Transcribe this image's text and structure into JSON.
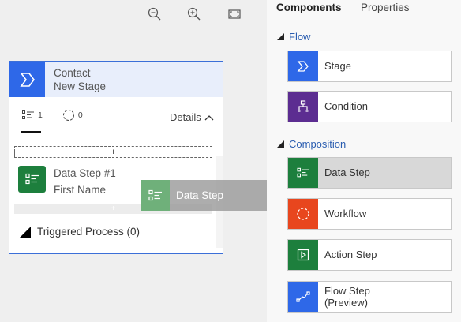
{
  "toolbar": {
    "zoom_out_icon": "zoom-out-icon",
    "zoom_in_icon": "zoom-in-icon",
    "fit_icon": "fit-to-screen-icon"
  },
  "stage": {
    "title": "Contact",
    "subtitle": "New Stage",
    "step_count": "1",
    "workflow_count": "0",
    "details_label": "Details",
    "drop_plus": "+",
    "data_step": {
      "title": "Data Step #1",
      "subtitle": "First Name"
    },
    "insert_plus": "+",
    "triggered_label": "Triggered Process (0)"
  },
  "drag_ghost": {
    "label": "Data Step"
  },
  "panel": {
    "tabs": [
      "Components",
      "Properties"
    ],
    "groups": [
      {
        "label": "Flow",
        "items": [
          {
            "label": "Stage",
            "color": "#2e68e8"
          },
          {
            "label": "Condition",
            "color": "#5c2d91"
          }
        ]
      },
      {
        "label": "Composition",
        "items": [
          {
            "label": "Data Step",
            "color": "#1d7f3d"
          },
          {
            "label": "Workflow",
            "color": "#e8461e"
          },
          {
            "label": "Action Step",
            "color": "#1d7f3d"
          },
          {
            "label": "Flow Step",
            "label2": "(Preview)",
            "color": "#2e68e8"
          }
        ]
      }
    ]
  },
  "colors": {
    "accent_blue": "#2e68e8",
    "panel_bg": "#f8f8f8",
    "canvas_bg": "#efefef"
  }
}
